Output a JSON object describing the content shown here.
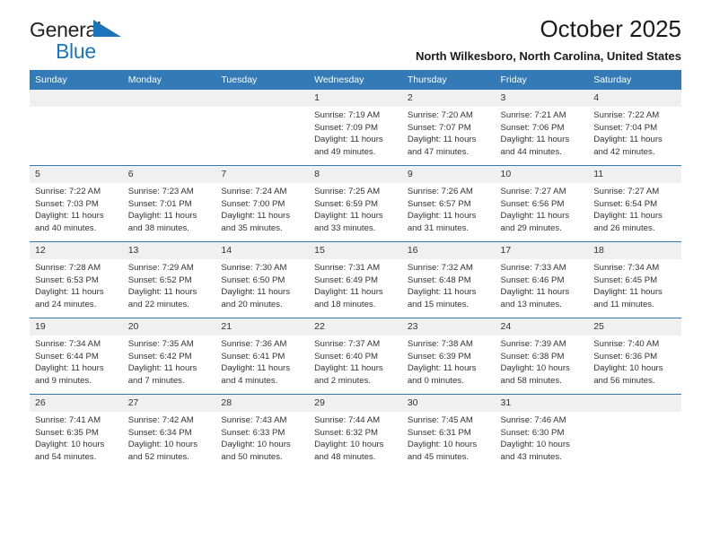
{
  "brand": {
    "name_top": "General",
    "name_bottom": "Blue",
    "triangle_color": "#1b75bb"
  },
  "header": {
    "title": "October 2025",
    "subtitle": "North Wilkesboro, North Carolina, United States"
  },
  "theme": {
    "header_bg": "#337ab7",
    "daynum_bg": "#f0f0f0",
    "row_rule": "#337ab7",
    "text": "#333333"
  },
  "calendar": {
    "weekday_headers": [
      "Sunday",
      "Monday",
      "Tuesday",
      "Wednesday",
      "Thursday",
      "Friday",
      "Saturday"
    ],
    "weeks": [
      [
        {
          "day": "",
          "empty": true
        },
        {
          "day": "",
          "empty": true
        },
        {
          "day": "",
          "empty": true
        },
        {
          "day": "1",
          "sunrise": "Sunrise: 7:19 AM",
          "sunset": "Sunset: 7:09 PM",
          "daylight_line1": "Daylight: 11 hours",
          "daylight_line2": "and 49 minutes."
        },
        {
          "day": "2",
          "sunrise": "Sunrise: 7:20 AM",
          "sunset": "Sunset: 7:07 PM",
          "daylight_line1": "Daylight: 11 hours",
          "daylight_line2": "and 47 minutes."
        },
        {
          "day": "3",
          "sunrise": "Sunrise: 7:21 AM",
          "sunset": "Sunset: 7:06 PM",
          "daylight_line1": "Daylight: 11 hours",
          "daylight_line2": "and 44 minutes."
        },
        {
          "day": "4",
          "sunrise": "Sunrise: 7:22 AM",
          "sunset": "Sunset: 7:04 PM",
          "daylight_line1": "Daylight: 11 hours",
          "daylight_line2": "and 42 minutes."
        }
      ],
      [
        {
          "day": "5",
          "sunrise": "Sunrise: 7:22 AM",
          "sunset": "Sunset: 7:03 PM",
          "daylight_line1": "Daylight: 11 hours",
          "daylight_line2": "and 40 minutes."
        },
        {
          "day": "6",
          "sunrise": "Sunrise: 7:23 AM",
          "sunset": "Sunset: 7:01 PM",
          "daylight_line1": "Daylight: 11 hours",
          "daylight_line2": "and 38 minutes."
        },
        {
          "day": "7",
          "sunrise": "Sunrise: 7:24 AM",
          "sunset": "Sunset: 7:00 PM",
          "daylight_line1": "Daylight: 11 hours",
          "daylight_line2": "and 35 minutes."
        },
        {
          "day": "8",
          "sunrise": "Sunrise: 7:25 AM",
          "sunset": "Sunset: 6:59 PM",
          "daylight_line1": "Daylight: 11 hours",
          "daylight_line2": "and 33 minutes."
        },
        {
          "day": "9",
          "sunrise": "Sunrise: 7:26 AM",
          "sunset": "Sunset: 6:57 PM",
          "daylight_line1": "Daylight: 11 hours",
          "daylight_line2": "and 31 minutes."
        },
        {
          "day": "10",
          "sunrise": "Sunrise: 7:27 AM",
          "sunset": "Sunset: 6:56 PM",
          "daylight_line1": "Daylight: 11 hours",
          "daylight_line2": "and 29 minutes."
        },
        {
          "day": "11",
          "sunrise": "Sunrise: 7:27 AM",
          "sunset": "Sunset: 6:54 PM",
          "daylight_line1": "Daylight: 11 hours",
          "daylight_line2": "and 26 minutes."
        }
      ],
      [
        {
          "day": "12",
          "sunrise": "Sunrise: 7:28 AM",
          "sunset": "Sunset: 6:53 PM",
          "daylight_line1": "Daylight: 11 hours",
          "daylight_line2": "and 24 minutes."
        },
        {
          "day": "13",
          "sunrise": "Sunrise: 7:29 AM",
          "sunset": "Sunset: 6:52 PM",
          "daylight_line1": "Daylight: 11 hours",
          "daylight_line2": "and 22 minutes."
        },
        {
          "day": "14",
          "sunrise": "Sunrise: 7:30 AM",
          "sunset": "Sunset: 6:50 PM",
          "daylight_line1": "Daylight: 11 hours",
          "daylight_line2": "and 20 minutes."
        },
        {
          "day": "15",
          "sunrise": "Sunrise: 7:31 AM",
          "sunset": "Sunset: 6:49 PM",
          "daylight_line1": "Daylight: 11 hours",
          "daylight_line2": "and 18 minutes."
        },
        {
          "day": "16",
          "sunrise": "Sunrise: 7:32 AM",
          "sunset": "Sunset: 6:48 PM",
          "daylight_line1": "Daylight: 11 hours",
          "daylight_line2": "and 15 minutes."
        },
        {
          "day": "17",
          "sunrise": "Sunrise: 7:33 AM",
          "sunset": "Sunset: 6:46 PM",
          "daylight_line1": "Daylight: 11 hours",
          "daylight_line2": "and 13 minutes."
        },
        {
          "day": "18",
          "sunrise": "Sunrise: 7:34 AM",
          "sunset": "Sunset: 6:45 PM",
          "daylight_line1": "Daylight: 11 hours",
          "daylight_line2": "and 11 minutes."
        }
      ],
      [
        {
          "day": "19",
          "sunrise": "Sunrise: 7:34 AM",
          "sunset": "Sunset: 6:44 PM",
          "daylight_line1": "Daylight: 11 hours",
          "daylight_line2": "and 9 minutes."
        },
        {
          "day": "20",
          "sunrise": "Sunrise: 7:35 AM",
          "sunset": "Sunset: 6:42 PM",
          "daylight_line1": "Daylight: 11 hours",
          "daylight_line2": "and 7 minutes."
        },
        {
          "day": "21",
          "sunrise": "Sunrise: 7:36 AM",
          "sunset": "Sunset: 6:41 PM",
          "daylight_line1": "Daylight: 11 hours",
          "daylight_line2": "and 4 minutes."
        },
        {
          "day": "22",
          "sunrise": "Sunrise: 7:37 AM",
          "sunset": "Sunset: 6:40 PM",
          "daylight_line1": "Daylight: 11 hours",
          "daylight_line2": "and 2 minutes."
        },
        {
          "day": "23",
          "sunrise": "Sunrise: 7:38 AM",
          "sunset": "Sunset: 6:39 PM",
          "daylight_line1": "Daylight: 11 hours",
          "daylight_line2": "and 0 minutes."
        },
        {
          "day": "24",
          "sunrise": "Sunrise: 7:39 AM",
          "sunset": "Sunset: 6:38 PM",
          "daylight_line1": "Daylight: 10 hours",
          "daylight_line2": "and 58 minutes."
        },
        {
          "day": "25",
          "sunrise": "Sunrise: 7:40 AM",
          "sunset": "Sunset: 6:36 PM",
          "daylight_line1": "Daylight: 10 hours",
          "daylight_line2": "and 56 minutes."
        }
      ],
      [
        {
          "day": "26",
          "sunrise": "Sunrise: 7:41 AM",
          "sunset": "Sunset: 6:35 PM",
          "daylight_line1": "Daylight: 10 hours",
          "daylight_line2": "and 54 minutes."
        },
        {
          "day": "27",
          "sunrise": "Sunrise: 7:42 AM",
          "sunset": "Sunset: 6:34 PM",
          "daylight_line1": "Daylight: 10 hours",
          "daylight_line2": "and 52 minutes."
        },
        {
          "day": "28",
          "sunrise": "Sunrise: 7:43 AM",
          "sunset": "Sunset: 6:33 PM",
          "daylight_line1": "Daylight: 10 hours",
          "daylight_line2": "and 50 minutes."
        },
        {
          "day": "29",
          "sunrise": "Sunrise: 7:44 AM",
          "sunset": "Sunset: 6:32 PM",
          "daylight_line1": "Daylight: 10 hours",
          "daylight_line2": "and 48 minutes."
        },
        {
          "day": "30",
          "sunrise": "Sunrise: 7:45 AM",
          "sunset": "Sunset: 6:31 PM",
          "daylight_line1": "Daylight: 10 hours",
          "daylight_line2": "and 45 minutes."
        },
        {
          "day": "31",
          "sunrise": "Sunrise: 7:46 AM",
          "sunset": "Sunset: 6:30 PM",
          "daylight_line1": "Daylight: 10 hours",
          "daylight_line2": "and 43 minutes."
        },
        {
          "day": "",
          "empty": true
        }
      ]
    ]
  }
}
